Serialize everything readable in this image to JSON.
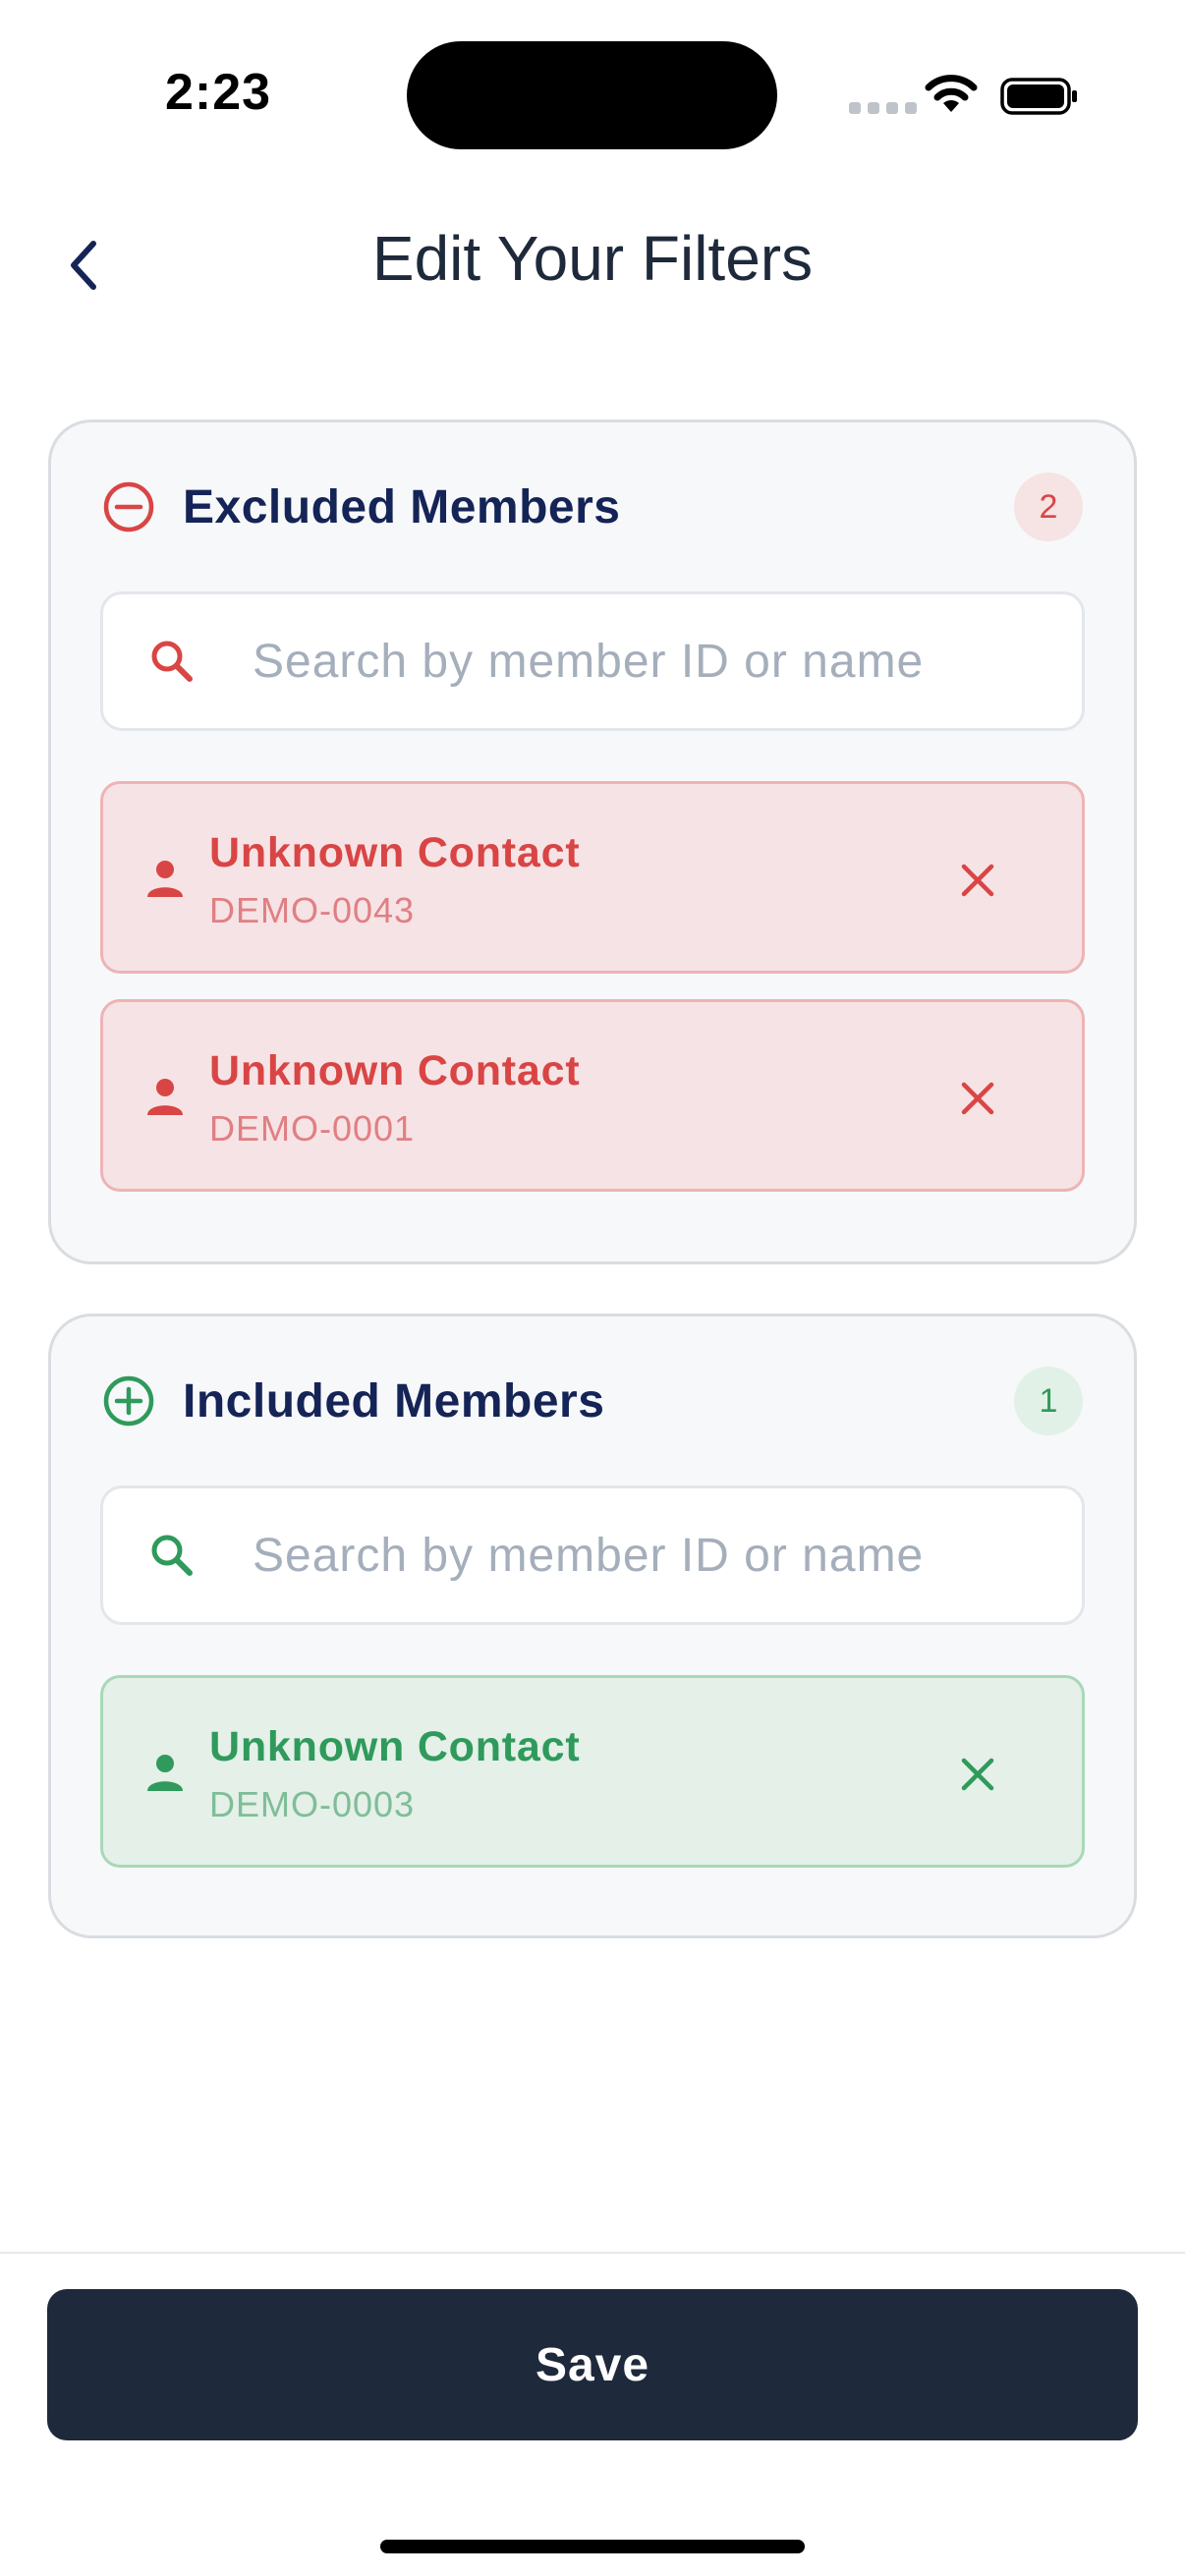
{
  "status_bar": {
    "time": "2:23"
  },
  "header": {
    "title": "Edit Your Filters",
    "back_icon": "chevron-left-icon"
  },
  "colors": {
    "excluded_accent": "#d94545",
    "included_accent": "#2f9a5b",
    "title_navy": "#152456",
    "save_button_bg": "#1e293b"
  },
  "excluded": {
    "title": "Excluded Members",
    "count": "2",
    "icon": "minus-circle-icon",
    "search_placeholder": "Search by member ID or name",
    "search_value": "",
    "members": [
      {
        "name": "Unknown Contact",
        "id": "DEMO-0043"
      },
      {
        "name": "Unknown Contact",
        "id": "DEMO-0001"
      }
    ]
  },
  "included": {
    "title": "Included Members",
    "count": "1",
    "icon": "plus-circle-icon",
    "search_placeholder": "Search by member ID or name",
    "search_value": "",
    "members": [
      {
        "name": "Unknown Contact",
        "id": "DEMO-0003"
      }
    ]
  },
  "footer": {
    "save_label": "Save"
  }
}
